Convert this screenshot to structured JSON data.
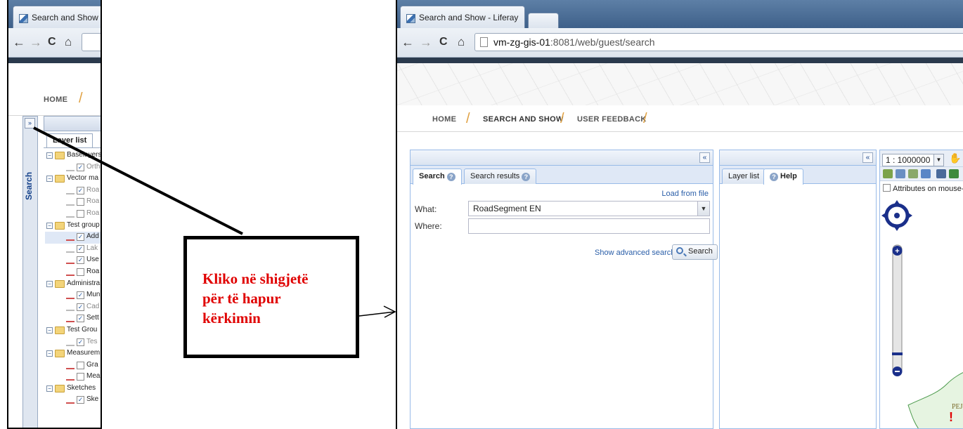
{
  "left_screenshot": {
    "browser_tab_title": "Search and Show -",
    "nav": {
      "back": "←",
      "forward": "→",
      "reload": "C",
      "home": "⌂"
    },
    "menu": {
      "home": "HOME",
      "sep": "/"
    },
    "expand_button": "»",
    "side_label": "Search",
    "layer_tab": "Layer list",
    "tree": [
      {
        "type": "group",
        "label": "Baselayers"
      },
      {
        "type": "layer",
        "label": "Ortho",
        "checked": true,
        "grey": true
      },
      {
        "type": "group",
        "label": "Vector ma"
      },
      {
        "type": "layer",
        "label": "Roa",
        "checked": true,
        "grey": true
      },
      {
        "type": "layer",
        "label": "Roa",
        "checked": false,
        "grey": true
      },
      {
        "type": "layer",
        "label": "Roa",
        "checked": false,
        "grey": true
      },
      {
        "type": "group",
        "label": "Test group"
      },
      {
        "type": "layer",
        "label": "Add",
        "checked": true,
        "grey": false,
        "selected": true
      },
      {
        "type": "layer",
        "label": "Lak",
        "checked": true,
        "grey": true
      },
      {
        "type": "layer",
        "label": "Use",
        "checked": true,
        "grey": false
      },
      {
        "type": "layer",
        "label": "Roa",
        "checked": false,
        "grey": false
      },
      {
        "type": "group",
        "label": "Administra"
      },
      {
        "type": "layer",
        "label": "Mun",
        "checked": true,
        "grey": false
      },
      {
        "type": "layer",
        "label": "Cad",
        "checked": true,
        "grey": true
      },
      {
        "type": "layer",
        "label": "Sett",
        "checked": true,
        "grey": false
      },
      {
        "type": "group",
        "label": "Test Grou"
      },
      {
        "type": "layer",
        "label": "Tes",
        "checked": true,
        "grey": true
      },
      {
        "type": "group",
        "label": "Measurem"
      },
      {
        "type": "layer",
        "label": "Gra",
        "checked": false,
        "grey": false
      },
      {
        "type": "layer",
        "label": "Mea",
        "checked": false,
        "grey": false
      },
      {
        "type": "group",
        "label": "Sketches"
      },
      {
        "type": "layer",
        "label": "Ske",
        "checked": true,
        "grey": false
      }
    ]
  },
  "right_screenshot": {
    "browser_tab_title": "Search and Show - Liferay",
    "tab_close": "×",
    "url_host": "vm-zg-gis-01",
    "url_rest": ":8081/web/guest/search",
    "menu": {
      "home": "HOME",
      "search_and_show": "SEARCH AND SHOW",
      "user_feedback": "USER FEEDBACK",
      "sep": "/"
    },
    "search_panel": {
      "collapse": "«",
      "tab_search": "Search",
      "tab_results": "Search results",
      "load_from_file": "Load from file",
      "what_label": "What:",
      "what_value": "RoadSegment EN",
      "where_label": "Where:",
      "where_value": "",
      "advanced_link": "Show advanced search",
      "search_button": "Search"
    },
    "layer_panel": {
      "collapse": "«",
      "tab_layer_list": "Layer list",
      "tab_help": "Help"
    },
    "map_panel": {
      "scale": "1 : 1000000",
      "attributes_checkbox": "Attributes on mouse-ov",
      "map_label": "PEJ"
    }
  },
  "annotation": {
    "text_lines": [
      "Kliko në shigjetë",
      "për të hapur",
      "kërkimin"
    ],
    "color": "#e00000"
  }
}
